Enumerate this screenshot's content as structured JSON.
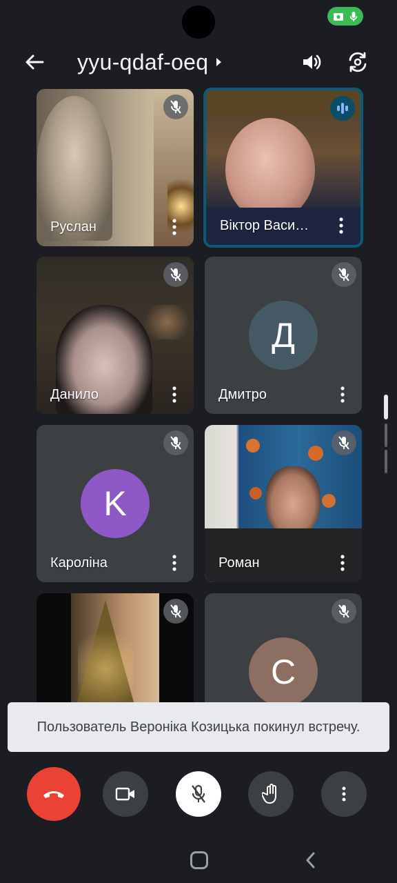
{
  "meeting": {
    "code": "yyu-qdaf-oeq"
  },
  "participants": [
    {
      "name": "Руслан",
      "muted": true,
      "video": true
    },
    {
      "name": "Віктор Васи…",
      "muted": false,
      "speaking": true,
      "video": true
    },
    {
      "name": "Данило",
      "muted": true,
      "video": true
    },
    {
      "name": "Дмитро",
      "muted": true,
      "video": false,
      "initial": "Д",
      "avatar_color": "#455a64"
    },
    {
      "name": "Кароліна",
      "muted": true,
      "video": false,
      "initial": "K",
      "avatar_color": "#8e59c7"
    },
    {
      "name": "Роман",
      "muted": true,
      "video": true
    },
    {
      "name": "",
      "muted": true,
      "video": true
    },
    {
      "name": "",
      "muted": true,
      "video": false,
      "initial": "C",
      "avatar_color": "#8d6e63"
    }
  ],
  "toast": {
    "message": "Пользователь Вероніка Козицька покинул встречу."
  },
  "controls": {
    "end_call_color": "#ea4335",
    "mic_state": "muted",
    "buttons": [
      "end-call",
      "camera",
      "microphone",
      "raise-hand",
      "more-options"
    ]
  },
  "colors": {
    "accent": "#0b5a7a",
    "background": "#1b1d22",
    "tile": "#3c4043"
  }
}
